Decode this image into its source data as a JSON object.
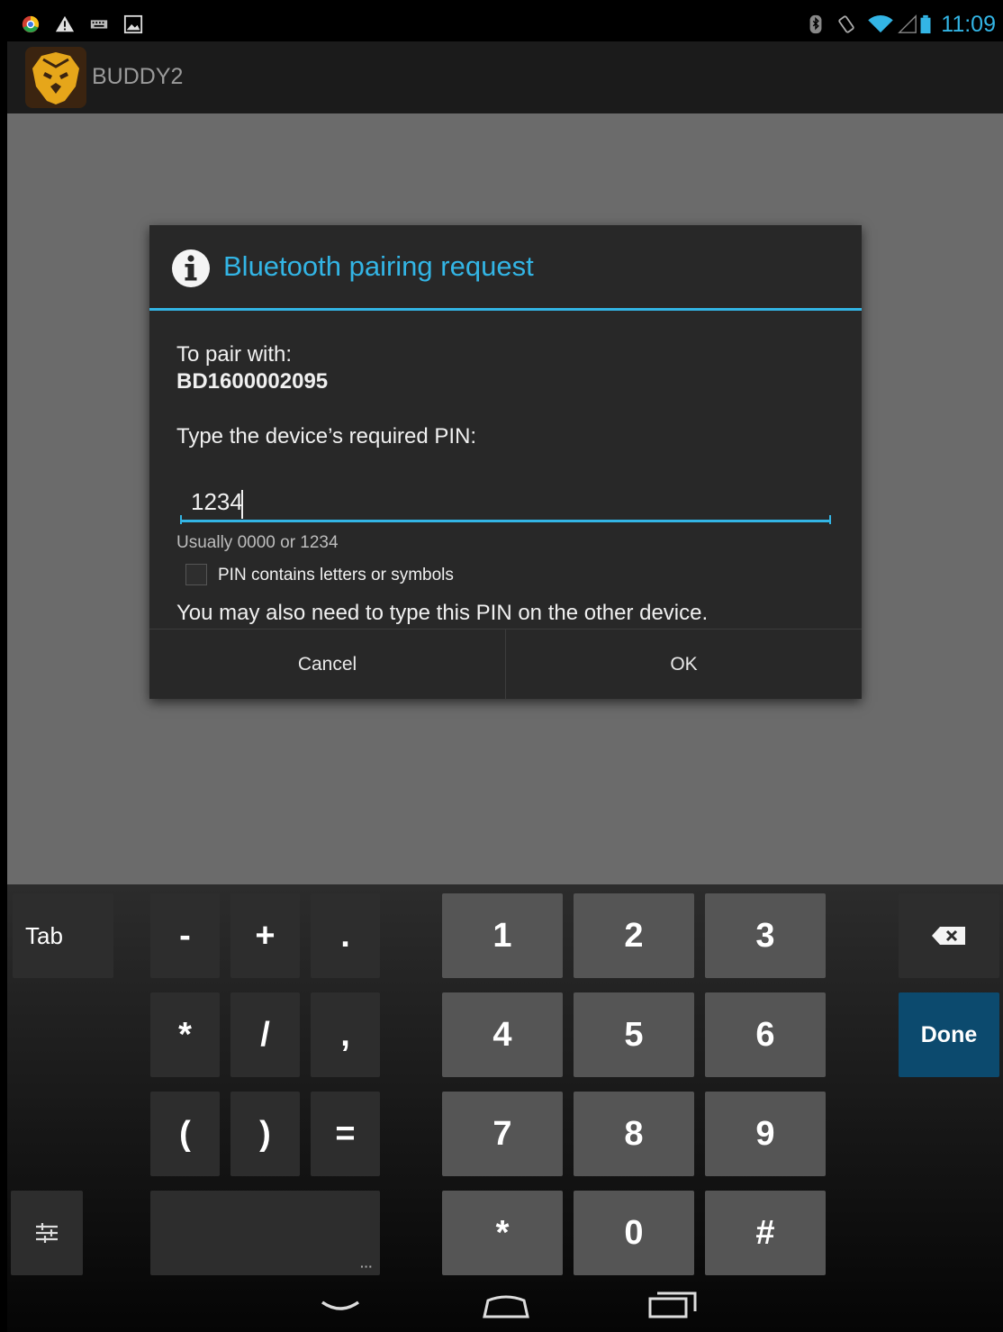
{
  "status_bar": {
    "time": "11:09",
    "left_icons": [
      "chrome-icon",
      "warning-icon",
      "keyboard-icon",
      "image-icon"
    ],
    "right_icons": [
      "bluetooth-icon",
      "rotate-icon",
      "wifi-icon",
      "signal-icon",
      "battery-icon"
    ],
    "accent": "#33b5e5"
  },
  "action_bar": {
    "title": "BUDDY2",
    "icon": "lion-logo-icon"
  },
  "dialog": {
    "title": "Bluetooth pairing request",
    "pair_label": "To pair with:",
    "device_name": "BD1600002095",
    "pin_prompt": "Type the device’s required PIN:",
    "pin_value": "1234",
    "hint": "Usually 0000 or 1234",
    "checkbox_label": "PIN contains letters or symbols",
    "checkbox_checked": false,
    "note": "You may also need to type this PIN on the other device.",
    "cancel_label": "Cancel",
    "ok_label": "OK"
  },
  "keyboard": {
    "tab_label": "Tab",
    "done_label": "Done",
    "symbol_keys": [
      "-",
      "+",
      ".",
      "*",
      "/",
      ",",
      "(",
      ")",
      "="
    ],
    "number_keys": [
      "1",
      "2",
      "3",
      "4",
      "5",
      "6",
      "7",
      "8",
      "9",
      "*",
      "0",
      "#"
    ],
    "done_color": "#0c4a6e"
  }
}
